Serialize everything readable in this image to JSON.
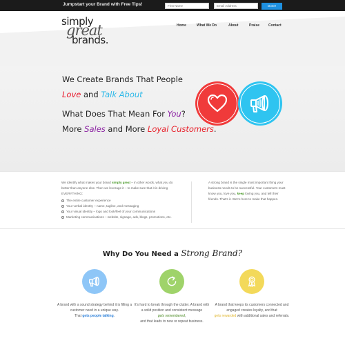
{
  "topbar": {
    "tagline": "Jumpstart your Brand with Free Tips!",
    "first_name_placeholder": "First Name",
    "email_placeholder": "Email Address",
    "submit_label": "Done!"
  },
  "logo": {
    "line1": "simply",
    "line2": "great",
    "line3": "brands."
  },
  "nav": {
    "items": [
      {
        "label": "Home"
      },
      {
        "label": "What We Do"
      },
      {
        "label": "About"
      },
      {
        "label": "Praise"
      },
      {
        "label": "Contact"
      }
    ]
  },
  "hero": {
    "line1": "We Create Brands That People",
    "line2_a": "Love",
    "line2_b": " and ",
    "line2_c": "Talk About",
    "line3_a": "What Does That Mean For ",
    "line3_b": "You",
    "line3_c": "?",
    "line4_a": "More ",
    "line4_b": "Sales",
    "line4_c": " and More ",
    "line4_d": "Loyal Customers",
    "line4_e": ".",
    "icons": [
      "heart-icon",
      "megaphone-icon"
    ],
    "colors": {
      "red": "#f03a3a",
      "blue": "#2fc4f0",
      "purple": "#8a1fa1"
    }
  },
  "band": {
    "col1_intro_a": "We identify what makes your brand ",
    "col1_intro_hl": "simply great",
    "col1_intro_b": " – in other words, what you do better than anyone else.   Then we leverage it – to make sure that it is driving EVERYTHING:",
    "bullets": [
      "The entire customer experience",
      "Your verbal identity – name, tagline, and messaging",
      "Your visual identity – logo and look/feel of your communications",
      "Marketing communications – website, signage, ads, blogs, promotions, etc."
    ],
    "col2_a": "A strong brand is the single most important thing your business needs to be successful.  Your customers must know you, love you, ",
    "col2_hl": "keep",
    "col2_b": " loving you, and tell their friends.  That's it.  We're here to make that happen."
  },
  "why": {
    "title_a": "Why Do You Need a ",
    "title_script": "Strong Brand?",
    "features": [
      {
        "icon": "megaphone-icon",
        "color": "#8ec6f7",
        "text_a": "A brand with a sound strategy behind it is filling a customer need in a unique way.",
        "text_pre": "That ",
        "text_hl": "gets people talking",
        "text_post": "."
      },
      {
        "icon": "refresh-icon",
        "color": "#9fd36a",
        "text_a": "It's hard to break through the clutter.  A brand with a solid position and consistent message",
        "text_hl": "gets remembered",
        "text_post": ",",
        "text_b": "and that leads to new or repeat business."
      },
      {
        "icon": "award-ribbon-icon",
        "color": "#f3d95a",
        "text_a": "A brand that keeps its customers connected and engaged creates loyalty, and that",
        "text_hl": "gets rewarded",
        "text_b": " with additional sales and referrals."
      }
    ]
  }
}
